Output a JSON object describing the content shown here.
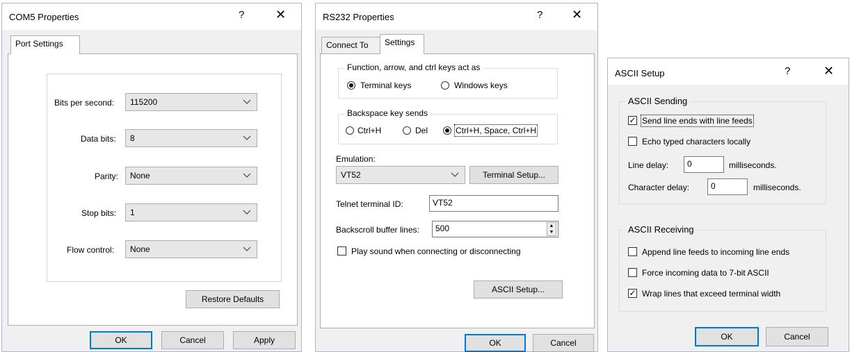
{
  "com5": {
    "title": "COM5 Properties",
    "help": "?",
    "close": "✕",
    "tab": "Port Settings",
    "fields": [
      {
        "label": "Bits per second:",
        "value": "115200"
      },
      {
        "label": "Data bits:",
        "value": "8"
      },
      {
        "label": "Parity:",
        "value": "None"
      },
      {
        "label": "Stop bits:",
        "value": "1"
      },
      {
        "label": "Flow control:",
        "value": "None"
      }
    ],
    "restore": "Restore Defaults",
    "ok": "OK",
    "cancel": "Cancel",
    "apply": "Apply"
  },
  "rs232": {
    "title": "RS232 Properties",
    "help": "?",
    "close": "✕",
    "tabs": [
      "Connect To",
      "Settings"
    ],
    "fn_group": {
      "legend": "Function, arrow, and ctrl keys act as",
      "options": [
        "Terminal keys",
        "Windows keys"
      ],
      "selected": "Terminal keys"
    },
    "bs_group": {
      "legend": "Backspace key sends",
      "options": [
        "Ctrl+H",
        "Del",
        "Ctrl+H, Space, Ctrl+H"
      ],
      "selected": "Ctrl+H, Space, Ctrl+H"
    },
    "emulation_label": "Emulation:",
    "emulation_value": "VT52",
    "terminal_setup": "Terminal Setup...",
    "telnet_label": "Telnet terminal ID:",
    "telnet_value": "VT52",
    "backscroll_label": "Backscroll buffer lines:",
    "backscroll_value": "500",
    "play_sound": "Play sound when connecting or disconnecting",
    "ascii_setup": "ASCII Setup...",
    "ok": "OK",
    "cancel": "Cancel"
  },
  "ascii": {
    "title": "ASCII Setup",
    "help": "?",
    "close": "✕",
    "sending": {
      "legend": "ASCII Sending",
      "send_line_ends": "Send line ends with line feeds",
      "echo": "Echo typed characters locally",
      "line_delay_label": "Line delay:",
      "line_delay_value": "0",
      "line_delay_unit": "milliseconds.",
      "char_delay_label": "Character delay:",
      "char_delay_value": "0",
      "char_delay_unit": "milliseconds."
    },
    "receiving": {
      "legend": "ASCII Receiving",
      "append": "Append line feeds to incoming line ends",
      "force": "Force incoming data to 7-bit ASCII",
      "wrap": "Wrap lines that exceed terminal width"
    },
    "ok": "OK",
    "cancel": "Cancel"
  },
  "colors": {
    "accent": "#0078d7",
    "dialog_bg": "#f0f0f0",
    "border": "#adadad"
  }
}
